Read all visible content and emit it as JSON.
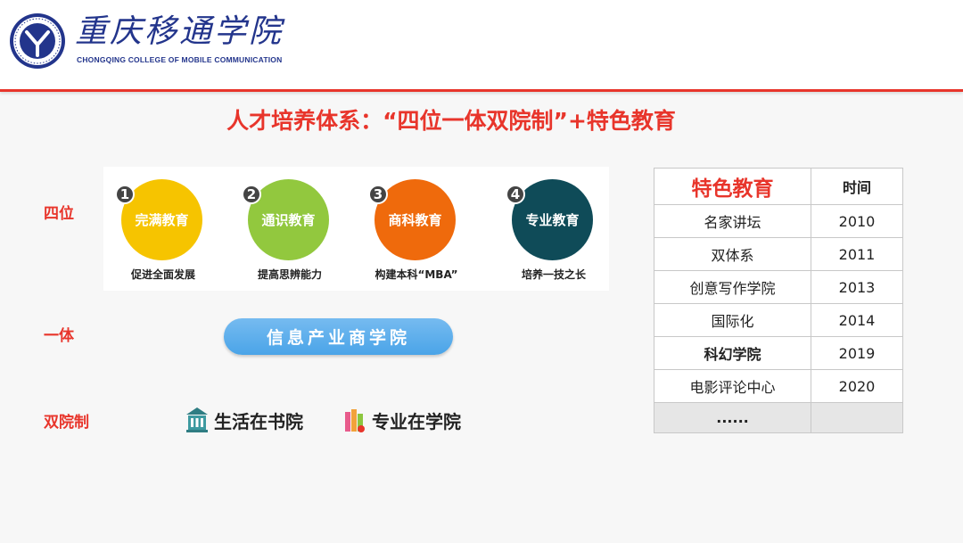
{
  "header": {
    "school_name_cn": "重庆移通学院",
    "school_name_en": "CHONGQING COLLEGE OF MOBILE COMMUNICATION"
  },
  "title": "人才培养体系：“四位一体双院制”+特色教育",
  "labels": {
    "siwei": "四位",
    "yiti": "一体",
    "shuangyuanzhi": "双院制"
  },
  "education": [
    {
      "num": "1",
      "name": "完满教育",
      "caption": "促进全面发展",
      "color": "#f6c400"
    },
    {
      "num": "2",
      "name": "通识教育",
      "caption": "提高思辨能力",
      "color": "#92c83e"
    },
    {
      "num": "3",
      "name": "商科教育",
      "caption": "构建本科“MBA”",
      "color": "#ef6a0c"
    },
    {
      "num": "4",
      "name": "专业教育",
      "caption": "培养一技之长",
      "color": "#0f4b58"
    }
  ],
  "pill": "信息产业商学院",
  "dual": [
    {
      "icon": "building-icon",
      "text": "生活在书院"
    },
    {
      "icon": "books-icon",
      "text": "专业在学院"
    }
  ],
  "table": {
    "header": [
      "特色教育",
      "时间"
    ],
    "rows": [
      {
        "name": "名家讲坛",
        "year": "2010"
      },
      {
        "name": "双体系",
        "year": "2011"
      },
      {
        "name": "创意写作学院",
        "year": "2013"
      },
      {
        "name": "国际化",
        "year": "2014"
      },
      {
        "name": "科幻学院",
        "year": "2019"
      },
      {
        "name": "电影评论中心",
        "year": "2020"
      },
      {
        "name": "......",
        "year": ""
      }
    ]
  },
  "colors": {
    "accent": "#e8352b",
    "brand": "#23358c",
    "pill": "#4aa4e8"
  }
}
